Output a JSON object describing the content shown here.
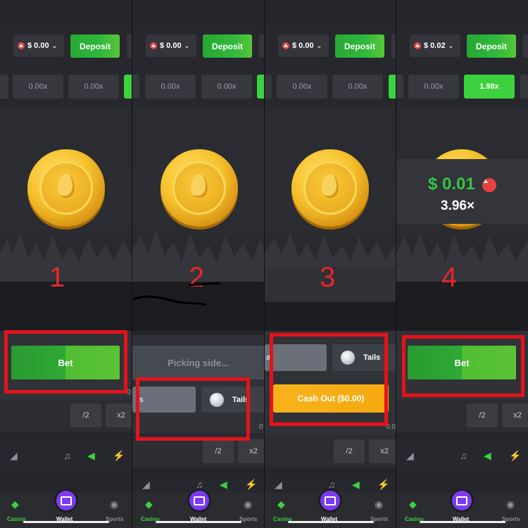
{
  "header": {
    "balances": [
      "$ 0.00",
      "$ 0.00",
      "$ 0.00",
      "$ 0.02"
    ],
    "deposit_label": "Deposit"
  },
  "multipliers": {
    "p1": [
      "0.00x",
      "0.00x"
    ],
    "p2": [
      "0.00x",
      "0.00x"
    ],
    "p3": [
      "0.00x",
      "0.00x"
    ],
    "p4": [
      "0.00x",
      "1.98x"
    ]
  },
  "steps": [
    "1",
    "2",
    "3",
    "4"
  ],
  "buttons": {
    "bet": "Bet",
    "picking_side": "Picking side...",
    "tails": "Tails",
    "cash_out": "Cash Out ($0.00)",
    "half": "/2",
    "double": "x2"
  },
  "win_popup": {
    "amount": "$ 0.01",
    "multiplier": "3.96×"
  },
  "nav": {
    "casino": "Casino",
    "wallet": "Wallet",
    "sports": "Sports"
  },
  "colors": {
    "accent_green": "#3cd23e",
    "cashout_orange": "#f7b31c",
    "highlight_red": "#e5121b",
    "wallet_purple": "#7b3af0"
  },
  "icons": [
    "avax-icon",
    "telegram-icon",
    "music-icon",
    "speaker-icon",
    "lightning-icon",
    "casino-icon",
    "wallet-icon",
    "sports-icon"
  ]
}
